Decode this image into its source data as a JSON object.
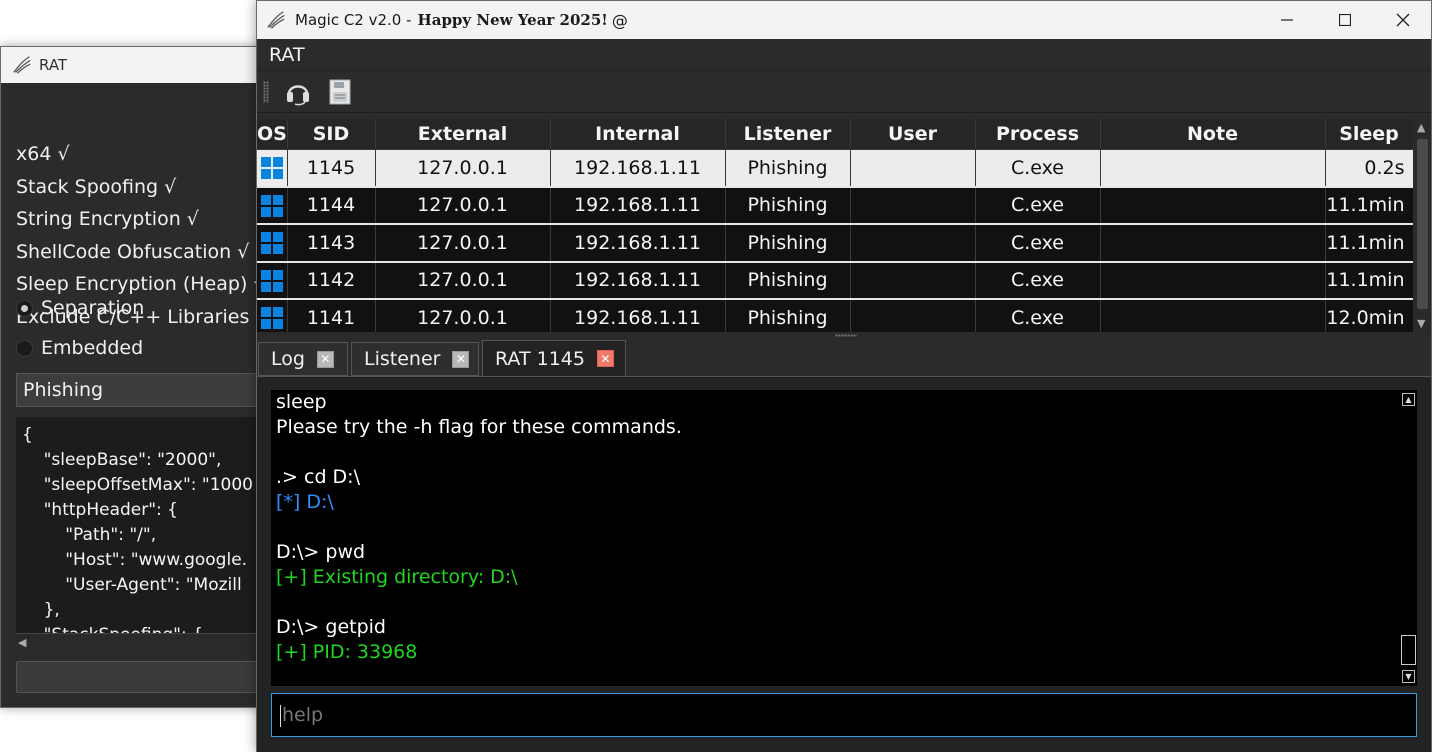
{
  "back_window": {
    "title": "RAT",
    "options": [
      "x64 √",
      "Stack Spoofing √",
      "String Encryption √",
      "ShellCode Obfuscation √",
      "Sleep Encryption (Heap) √",
      "Exclude C/C++ Libraries √"
    ],
    "radios": [
      {
        "label": "Separation",
        "selected": true
      },
      {
        "label": "Embedded",
        "selected": false
      }
    ],
    "listener_select": "Phishing",
    "config_lines": [
      "{",
      "    \"sleepBase\": \"2000\",",
      "    \"sleepOffsetMax\": \"1000",
      "    \"httpHeader\": {",
      "        \"Path\": \"/\",",
      "        \"Host\": \"www.google.",
      "        \"User-Agent\": \"Mozill",
      "    },",
      "    \"StackSpoofing\": {"
    ]
  },
  "main_window": {
    "title": "Magic C2 v2.0 -",
    "title_bold": "Happy New Year 2025!",
    "title_icon": "@",
    "menu": [
      "RAT"
    ],
    "toolbar": [
      "headset-icon",
      "save-icon"
    ],
    "table": {
      "columns": [
        "OS",
        "SID",
        "External",
        "Internal",
        "Listener",
        "User",
        "Process",
        "Note",
        "Sleep"
      ],
      "rows": [
        {
          "sid": "1145",
          "external": "127.0.0.1",
          "internal": "192.168.1.11",
          "listener": "Phishing",
          "user": "",
          "process": "C.exe",
          "note": "",
          "sleep": "0.2s",
          "selected": true
        },
        {
          "sid": "1144",
          "external": "127.0.0.1",
          "internal": "192.168.1.11",
          "listener": "Phishing",
          "user": "",
          "process": "C.exe",
          "note": "",
          "sleep": "11.1min"
        },
        {
          "sid": "1143",
          "external": "127.0.0.1",
          "internal": "192.168.1.11",
          "listener": "Phishing",
          "user": "",
          "process": "C.exe",
          "note": "",
          "sleep": "11.1min"
        },
        {
          "sid": "1142",
          "external": "127.0.0.1",
          "internal": "192.168.1.11",
          "listener": "Phishing",
          "user": "",
          "process": "C.exe",
          "note": "",
          "sleep": "11.1min"
        },
        {
          "sid": "1141",
          "external": "127.0.0.1",
          "internal": "192.168.1.11",
          "listener": "Phishing",
          "user": "",
          "process": "C.exe",
          "note": "",
          "sleep": "12.0min"
        }
      ]
    },
    "tabs": [
      {
        "label": "Log",
        "active": false
      },
      {
        "label": "Listener",
        "active": false
      },
      {
        "label": "RAT 1145",
        "active": true
      }
    ],
    "console_lines": [
      {
        "text": "sleep",
        "color": "white"
      },
      {
        "text": "Please try the -h flag for these commands.",
        "color": "white"
      },
      {
        "text": "",
        "color": "white"
      },
      {
        "text": ".> cd D:\\",
        "color": "white"
      },
      {
        "text": "[*] D:\\",
        "color": "blue"
      },
      {
        "text": "",
        "color": "white"
      },
      {
        "text": "D:\\> pwd",
        "color": "white"
      },
      {
        "text": "[+] Existing directory: D:\\",
        "color": "green"
      },
      {
        "text": "",
        "color": "white"
      },
      {
        "text": "D:\\> getpid",
        "color": "white"
      },
      {
        "text": "[+] PID: 33968",
        "color": "green"
      }
    ],
    "command_input": {
      "placeholder": "help",
      "value": ""
    }
  }
}
